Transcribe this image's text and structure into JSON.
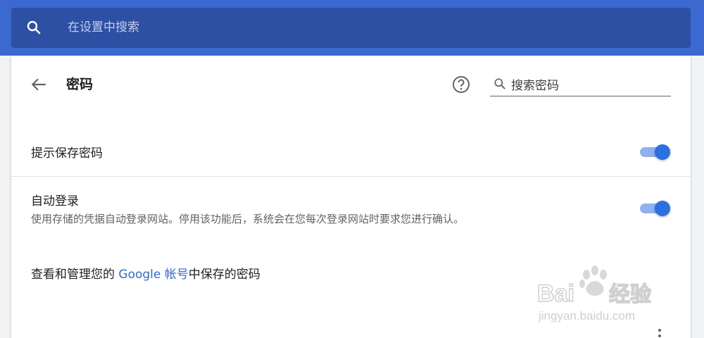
{
  "search": {
    "placeholder": "在设置中搜索",
    "icon": "search-icon"
  },
  "page": {
    "title": "密码",
    "back_icon": "arrow-back-icon",
    "help_icon": "help-circle-icon",
    "password_search": {
      "placeholder": "搜索密码",
      "icon": "search-icon"
    }
  },
  "settings": {
    "offer_save": {
      "label": "提示保存密码",
      "enabled": true
    },
    "auto_signin": {
      "label": "自动登录",
      "description": "使用存储的凭据自动登录网站。停用该功能后，系统会在您每次登录网站时要求您进行确认。",
      "enabled": true
    }
  },
  "manage": {
    "prefix": "查看和管理您的 ",
    "link": "Google 帐号",
    "suffix": "中保存的密码"
  },
  "watermark": {
    "brand": "Bai du 经验",
    "url": "jingyan.baidu.com"
  },
  "colors": {
    "header": "#3b69cf",
    "searchbox": "#2d4fa4",
    "accent": "#2b6fe0",
    "link": "#3367d6"
  }
}
